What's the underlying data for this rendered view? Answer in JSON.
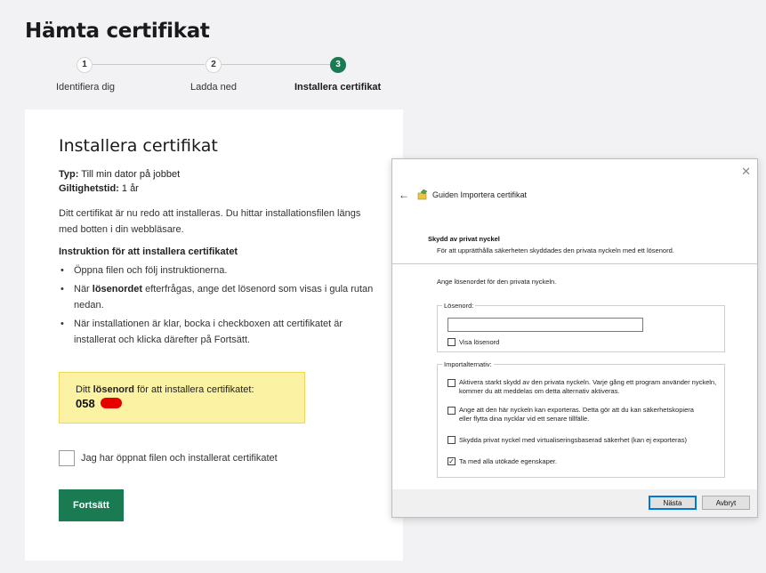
{
  "page": {
    "title": "Hämta certifikat"
  },
  "stepper": {
    "steps": [
      {
        "number": "1",
        "label": "Identifiera dig",
        "active": false
      },
      {
        "number": "2",
        "label": "Ladda ned",
        "active": false
      },
      {
        "number": "3",
        "label": "Installera certifikat",
        "active": true
      }
    ],
    "active_color": "#1a7a52"
  },
  "card": {
    "title": "Installera certifikat",
    "type_label": "Typ:",
    "type_value": "Till min dator på jobbet",
    "validity_label": "Giltighetstid:",
    "validity_value": "1 år",
    "description": "Ditt certifikat är nu redo att installeras. Du hittar installationsfilen längs med botten i din webbläsare.",
    "instructions_heading": "Instruktion för att installera certifikatet",
    "instructions": {
      "item1": "Öppna filen och följ instruktionerna.",
      "item2_pre": "När ",
      "item2_bold": "lösenordet",
      "item2_post": " efterfrågas, ange det lösenord som visas i gula rutan nedan.",
      "item3": "När installationen är klar, bocka i checkboxen att certifikatet är installerat och klicka därefter på Fortsätt."
    },
    "password_box": {
      "line_pre": "Ditt ",
      "line_bold": "lösenord",
      "line_post": " för att installera certifikatet:",
      "value_visible": "058",
      "redaction_color": "#e60000"
    },
    "confirm_checkbox_label": "Jag har öppnat filen och installerat certifikatet",
    "continue_button": "Fortsätt"
  },
  "dialog": {
    "close_glyph": "✕",
    "back_glyph": "←",
    "title": "Guiden Importera certifikat",
    "section_heading": "Skydd av privat nyckel",
    "section_description": "För att upprätthålla säkerheten skyddades den privata nyckeln med ett lösenord.",
    "prompt": "Ange lösenordet för den privata nyckeln.",
    "password_group_title": "Lösenord:",
    "password_value": "",
    "show_password_label": "Visa lösenord",
    "show_password_checked": false,
    "import_group_title": "Importalternativ:",
    "options": [
      {
        "label": "Aktivera starkt skydd av den privata nyckeln. Varje gång ett program använder nyckeln, kommer du att meddelas om detta alternativ aktiveras.",
        "checked": false
      },
      {
        "label": "Ange att den här nyckeln kan exporteras. Detta gör att du kan säkerhetskopiera eller flytta dina nycklar vid ett senare tillfälle.",
        "checked": false
      },
      {
        "label": "Skydda privat nyckel med virtualiseringsbaserad säkerhet (kan ej exporteras)",
        "checked": false
      },
      {
        "label": "Ta med alla utökade egenskaper.",
        "checked": true
      }
    ],
    "check_glyph": "✓",
    "next_button": "Nästa",
    "cancel_button": "Avbryt"
  }
}
